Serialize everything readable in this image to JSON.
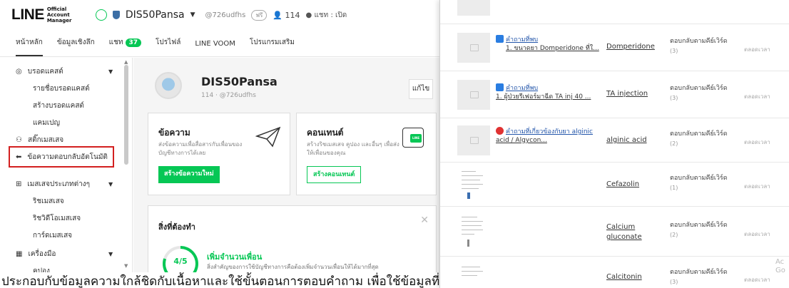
{
  "header": {
    "logo_main": "LINE",
    "logo_sub": "Official Account Manager",
    "account_name": "DIS50Pansa",
    "account_id": "@726udfhs",
    "plan_badge": "ฟรี",
    "friend_count": "114",
    "chat_status": "แชท : เปิด"
  },
  "nav": {
    "tabs": [
      "หน้าหลัก",
      "ข้อมูลเชิงลึก",
      "แชท",
      "โปรไฟล์",
      "LINE VOOM",
      "โปรแกรมเสริม"
    ],
    "chat_badge": "37",
    "active_tab": "หน้าหลัก"
  },
  "sidebar": {
    "broadcast_label": "บรอดแคสต์",
    "broadcast_items": [
      "รายชื่อบรอดแคสต์",
      "สร้างบรอดแคสต์",
      "แคมเปญ"
    ],
    "sticker_label": "สติ๊กเมสเสจ",
    "autoreply_label": "ข้อความตอบกลับอัตโนมัติ",
    "message_types_label": "เมสเสจประเภทต่างๆ",
    "message_items": [
      "ริชเมสเสจ",
      "ริชวิดีโอเมสเสจ",
      "การ์ดเมสเสจ"
    ],
    "tools_label": "เครื่องมือ",
    "tools_item_partial": "คูปอง"
  },
  "profile": {
    "name": "DIS50Pansa",
    "meta": "114 · @726udfhs",
    "edit_label": "แก้ไข"
  },
  "cards": {
    "message": {
      "title": "ข้อความ",
      "desc": "ส่งข้อความเพื่อสื่อสารกับเพื่อนของบัญชีทางการได้เลย",
      "button": "สร้างข้อความใหม่"
    },
    "content": {
      "title": "คอนเทนต์",
      "desc": "สร้างริชเมสเสจ คูปอง และอื่นๆ เพื่อส่งให้เพื่อนของคุณ",
      "button": "สร้างคอนเทนต์",
      "icon_label": "LINE"
    }
  },
  "todo": {
    "title": "สิ่งที่ต้องทำ",
    "progress_text": "4/5",
    "progress_fraction": 0.8,
    "heading": "เพิ่มจำนวนเพื่อน",
    "sub": "สิ่งสำคัญของการใช้บัญชีทางการคือต้องเพิ่มจำนวนเพื่อนให้ได้มากที่สุด"
  },
  "caption": "ประกอบกับข้อมูลความใกล้ชิดกับเนื้อหาและใช้ขั้นตอนการตอบคำถาม เพื่อใช้ข้อมูลที่ตอบกลับในรูปแบบ",
  "responses": {
    "rows": [
      {
        "thumb": "image",
        "icon": "blue",
        "tag": "คำถามที่พบ",
        "detail": "1. ขนาดยา Domperidone ที่ใ...",
        "keyword": "Domperidone",
        "mode": "ตอบกลับตามคีย์เวิร์ด",
        "mode_count": "(3)",
        "time": "ตลอดเวลา"
      },
      {
        "thumb": "image",
        "icon": "blue",
        "tag": "คำถามที่พบ",
        "detail": "1. ผู้ป่วยรีเฟอร์มาฉีด TA inj 40 ...",
        "keyword": "TA injection",
        "mode": "ตอบกลับตามคีย์เวิร์ด",
        "mode_count": "(3)",
        "time": "ตลอดเวลา"
      },
      {
        "thumb": "image",
        "icon": "red",
        "tag": "คำถามที่เกี่ยวข้องกับยา alginic",
        "detail": "acid / Algycon...",
        "keyword": "alginic acid",
        "mode": "ตอบกลับตามคีย์เวิร์ด",
        "mode_count": "(2)",
        "time": "ตลอดเวลา"
      },
      {
        "thumb": "doc",
        "icon": "",
        "tag": "",
        "detail": "",
        "keyword": "Cefazolin",
        "mode": "ตอบกลับตามคีย์เวิร์ด",
        "mode_count": "(1)",
        "time": "ตลอดเวลา"
      },
      {
        "thumb": "doc",
        "icon": "",
        "tag": "",
        "detail": "",
        "keyword": "Calcium gluconate",
        "mode": "ตอบกลับตามคีย์เวิร์ด",
        "mode_count": "(2)",
        "time": "ตลอดเวลา"
      },
      {
        "thumb": "doc",
        "icon": "",
        "tag": "",
        "detail": "",
        "keyword": "Calcitonin",
        "mode": "ตอบกลับตามคีย์เวิร์ด",
        "mode_count": "(3)",
        "time": "ตลอดเวลา"
      }
    ],
    "watermark": "Ac\nGo"
  }
}
